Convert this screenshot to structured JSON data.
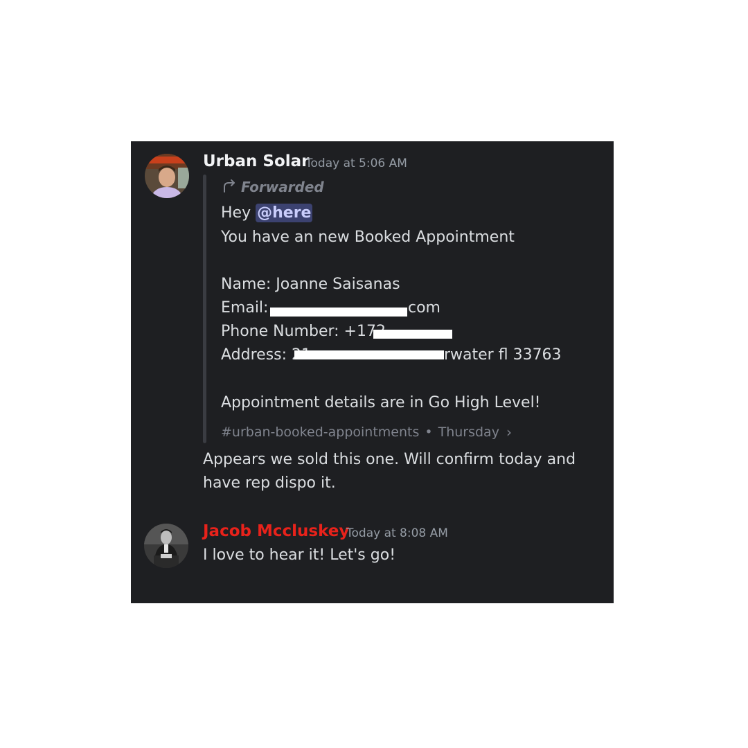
{
  "messages": [
    {
      "author": "Urban Solar",
      "author_color": "#f2f3f5",
      "timestamp": "Today at 5:06 AM",
      "avatar_icon": "urban-solar-avatar",
      "forwarded": {
        "label": "Forwarded",
        "icon": "forward-arrow-icon",
        "greeting": "Hey",
        "mention": "@here",
        "line_1": "You have an new Booked Appointment",
        "name_line": "Name: Joanne Saisanas",
        "email_label": "Email:",
        "email_visible_tail": "com",
        "phone_label": "Phone Number: +172",
        "address_label": "Address: 21",
        "address_visible_tail": "rwater fl  33763",
        "closing_line": "Appointment details are in Go High Level!",
        "channel": "#urban-booked-appointments",
        "channel_separator": "•",
        "channel_day": "Thursday",
        "channel_chevron": "›"
      },
      "reply": "Appears we sold this one. Will confirm today and have rep dispo it."
    },
    {
      "author": "Jacob Mccluskey",
      "author_color": "#e8221b",
      "timestamp": "Today at 8:08 AM",
      "avatar_icon": "jacob-avatar",
      "body": "I love to hear it! Let's go!"
    }
  ],
  "colors": {
    "panel_bg": "#1e1f22",
    "mention_bg": "#3c4270",
    "mention_text": "#c9cdfb",
    "muted": "#80848e"
  }
}
